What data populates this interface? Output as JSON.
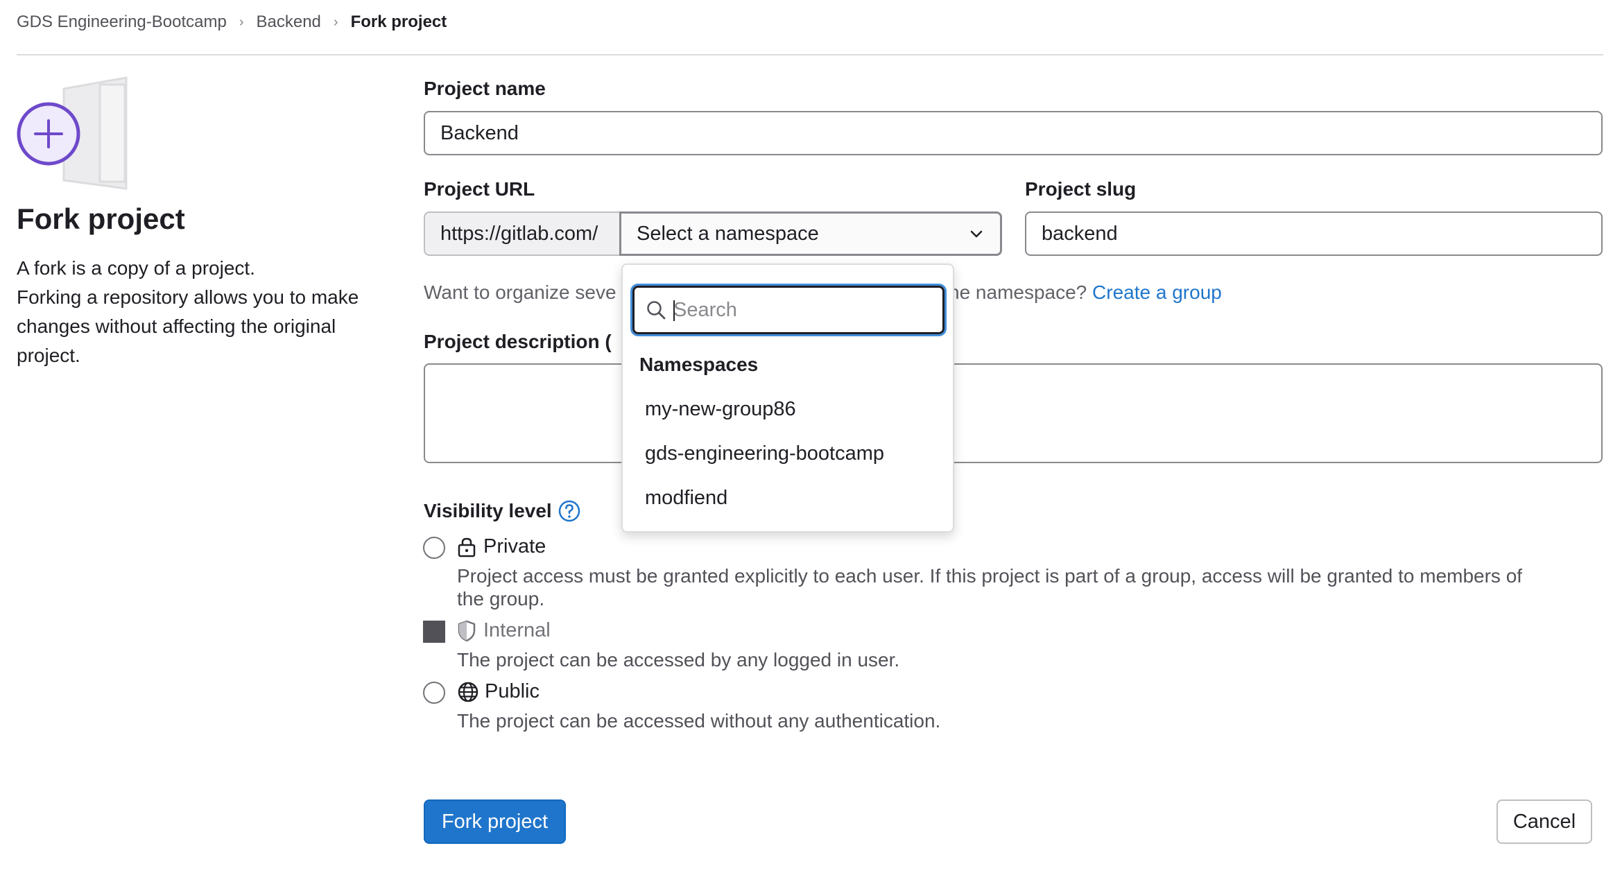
{
  "breadcrumb": {
    "items": [
      "GDS Engineering-Bootcamp",
      "Backend",
      "Fork project"
    ]
  },
  "left": {
    "title": "Fork project",
    "lines": [
      "A fork is a copy of a project.",
      "Forking a repository allows you to make",
      "changes without affecting the original",
      "project."
    ],
    "illustration_icon": "plus-circle-icon"
  },
  "form": {
    "project_name_label": "Project name",
    "project_name_value": "Backend",
    "project_url_label": "Project URL",
    "url_prefix": "https://gitlab.com/",
    "namespace_placeholder": "Select a namespace",
    "project_slug_label": "Project slug",
    "project_slug_value": "backend",
    "help_text_start": "Want to organize seve",
    "help_text_end": "ne namespace?",
    "create_group_link": "Create a group",
    "description_label": "Project description (",
    "visibility_label": "Visibility level",
    "visibility_options": [
      {
        "label": "Private",
        "desc_lines": [
          "Project access must be granted explicitly to each user. If this project is part of a group, access will be granted to members of",
          "the group."
        ],
        "icon": "lock-icon",
        "state": "unselected"
      },
      {
        "label": "Internal",
        "desc_lines": [
          "The project can be accessed by any logged in user."
        ],
        "icon": "shield-icon",
        "state": "disabled"
      },
      {
        "label": "Public",
        "desc_lines": [
          "The project can be accessed without any authentication."
        ],
        "icon": "globe-icon",
        "state": "unselected"
      }
    ]
  },
  "namespace_dropdown": {
    "search_placeholder": "Search",
    "header": "Namespaces",
    "items": [
      "my-new-group86",
      "gds-engineering-bootcamp",
      "modfiend"
    ]
  },
  "buttons": {
    "fork": "Fork project",
    "cancel": "Cancel"
  },
  "colors": {
    "primary": "#1f75cb",
    "illustration_purple": "#6e49cb",
    "focus_ring": "#428fdc"
  }
}
